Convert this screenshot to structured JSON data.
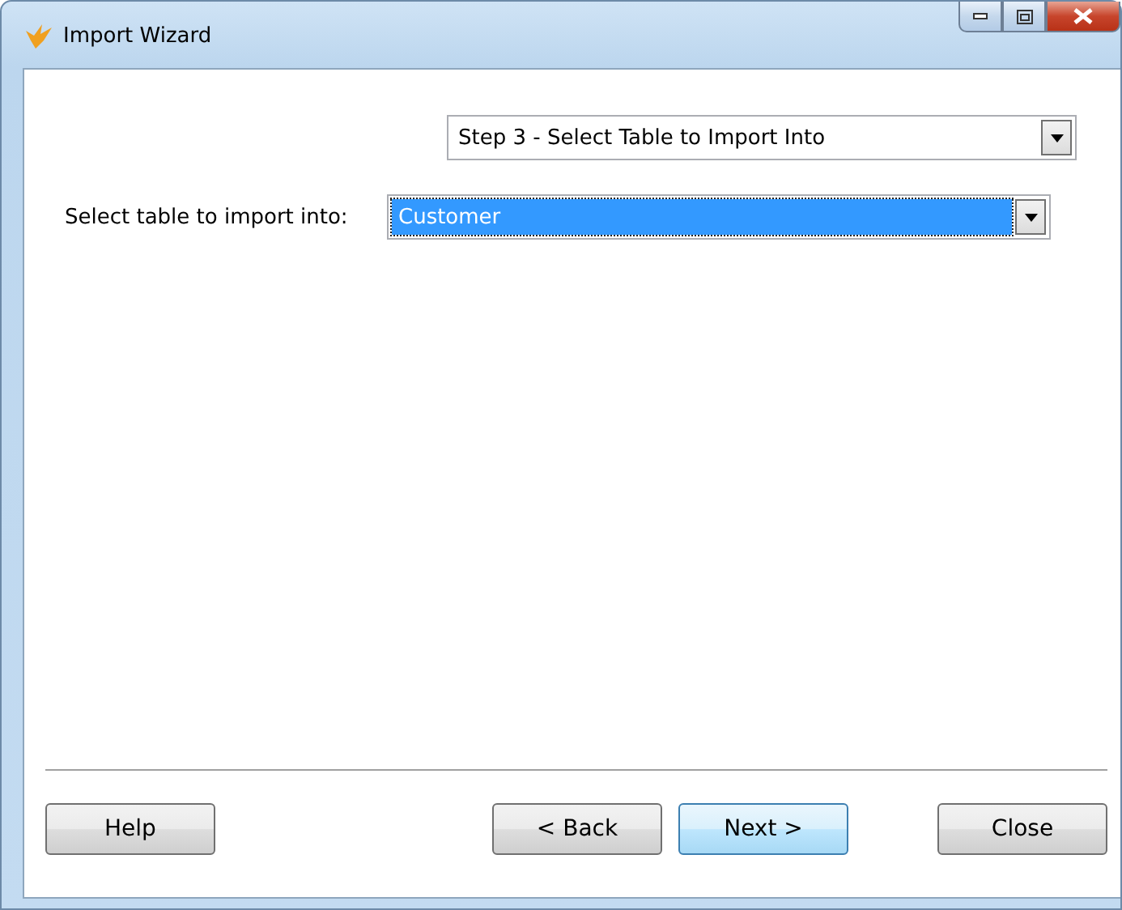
{
  "window": {
    "title": "Import Wizard"
  },
  "step_select": {
    "value": "Step 3 - Select Table to Import Into"
  },
  "table_select": {
    "label": "Select table to import into:",
    "value": "Customer",
    "focused": true
  },
  "buttons": [
    {
      "label": "Help",
      "default": false
    },
    {
      "label": "< Back",
      "default": false
    },
    {
      "label": "Next >",
      "default": true
    },
    {
      "label": "Close",
      "default": false
    }
  ]
}
